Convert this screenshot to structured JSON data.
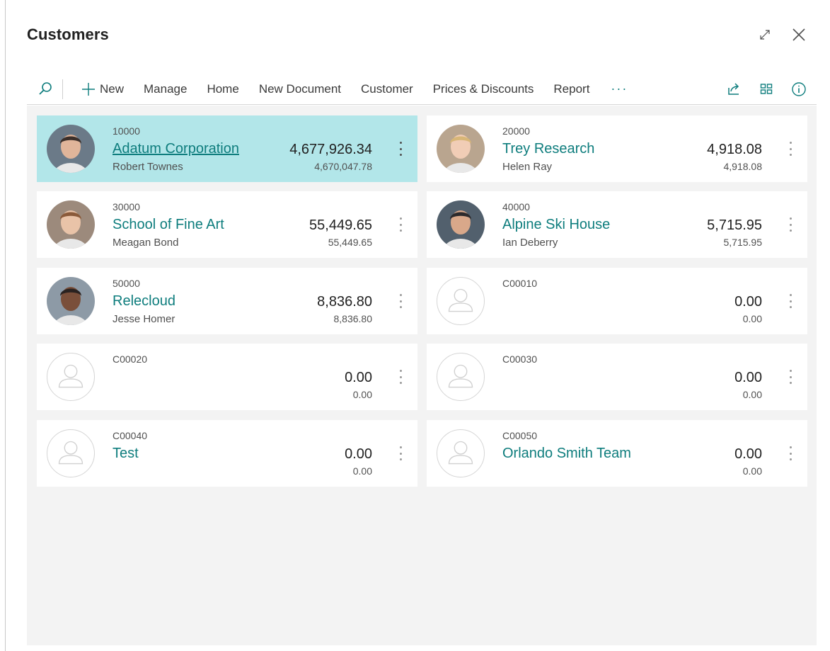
{
  "window": {
    "title": "Customers"
  },
  "actions": {
    "new": "New",
    "items": [
      "Manage",
      "Home",
      "New Document",
      "Customer",
      "Prices & Discounts",
      "Report"
    ],
    "more": "···"
  },
  "icons": {
    "search": "search-icon",
    "new": "plus-icon",
    "share": "share-icon",
    "layout": "grid-view-icon",
    "info": "info-icon",
    "expand": "expand-icon",
    "close": "close-icon"
  },
  "colors": {
    "accent": "#0e7d7d",
    "selected": "#b2e6e9",
    "background": "#f3f3f3"
  },
  "customers": [
    {
      "no": "10000",
      "name": "Adatum Corporation",
      "contact": "Robert Townes",
      "balance": "4,677,926.34",
      "balance_due": "4,670,047.78",
      "photo": "person-photo",
      "selected": true
    },
    {
      "no": "20000",
      "name": "Trey Research",
      "contact": "Helen Ray",
      "balance": "4,918.08",
      "balance_due": "4,918.08",
      "photo": "person-photo",
      "selected": false
    },
    {
      "no": "30000",
      "name": "School of Fine Art",
      "contact": "Meagan Bond",
      "balance": "55,449.65",
      "balance_due": "55,449.65",
      "photo": "person-photo",
      "selected": false
    },
    {
      "no": "40000",
      "name": "Alpine Ski House",
      "contact": "Ian Deberry",
      "balance": "5,715.95",
      "balance_due": "5,715.95",
      "photo": "person-photo",
      "selected": false
    },
    {
      "no": "50000",
      "name": "Relecloud",
      "contact": "Jesse Homer",
      "balance": "8,836.80",
      "balance_due": "8,836.80",
      "photo": "person-photo",
      "selected": false
    },
    {
      "no": "C00010",
      "name": "",
      "contact": "",
      "balance": "0.00",
      "balance_due": "0.00",
      "photo": "placeholder-avatar",
      "selected": false
    },
    {
      "no": "C00020",
      "name": "",
      "contact": "",
      "balance": "0.00",
      "balance_due": "0.00",
      "photo": "placeholder-avatar",
      "selected": false
    },
    {
      "no": "C00030",
      "name": "",
      "contact": "",
      "balance": "0.00",
      "balance_due": "0.00",
      "photo": "placeholder-avatar",
      "selected": false
    },
    {
      "no": "C00040",
      "name": "Test",
      "contact": "",
      "balance": "0.00",
      "balance_due": "0.00",
      "photo": "placeholder-avatar",
      "selected": false
    },
    {
      "no": "C00050",
      "name": "Orlando Smith Team",
      "contact": "",
      "balance": "0.00",
      "balance_due": "0.00",
      "photo": "placeholder-avatar",
      "selected": false
    }
  ]
}
